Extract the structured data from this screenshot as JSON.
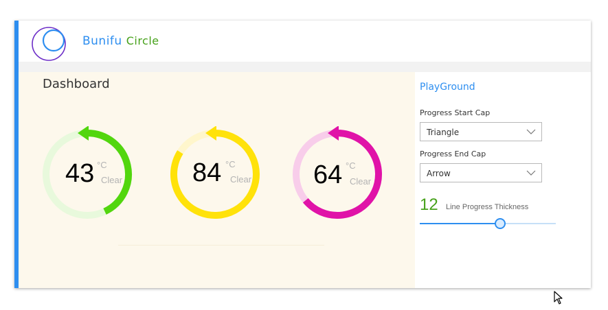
{
  "app": {
    "brand_part1": "Bunifu",
    "brand_part2": "Circle",
    "logo_icon": "ring-logo-icon"
  },
  "colors": {
    "accent": "#2d8ef0",
    "brand_green": "#46a11a",
    "dashboard_bg": "#fdf8ec"
  },
  "dashboard": {
    "title": "Dashboard",
    "gauges": [
      {
        "value": "43",
        "unit": "°C",
        "desc": "Clear",
        "color": "#52d60e",
        "text_color": "#46a11a",
        "track_color": "#e8f9dc",
        "start_cap": "triangle",
        "end_cap": "arrow"
      },
      {
        "value": "84",
        "unit": "°C",
        "desc": "Clear",
        "color": "#ffe20a",
        "text_color": "#e0c21a",
        "track_color": "#fff6cc",
        "start_cap": "triangle",
        "end_cap": "arrow"
      },
      {
        "value": "64",
        "unit": "°C",
        "desc": "Clear",
        "color": "#e013a8",
        "text_color": "#d61490",
        "track_color": "#f8cdea",
        "start_cap": "triangle",
        "end_cap": "arrow"
      }
    ]
  },
  "playground": {
    "title": "PlayGround",
    "start_cap_label": "Progress Start Cap",
    "start_cap_value": "Triangle",
    "end_cap_label": "Progress End Cap",
    "end_cap_value": "Arrow",
    "thickness_value": "12",
    "thickness_label": "Line Progress Thickness",
    "slider_fraction": 0.59
  },
  "icons": {
    "dropdown": "chevron-down-icon",
    "cursor": "mouse-pointer-icon"
  }
}
